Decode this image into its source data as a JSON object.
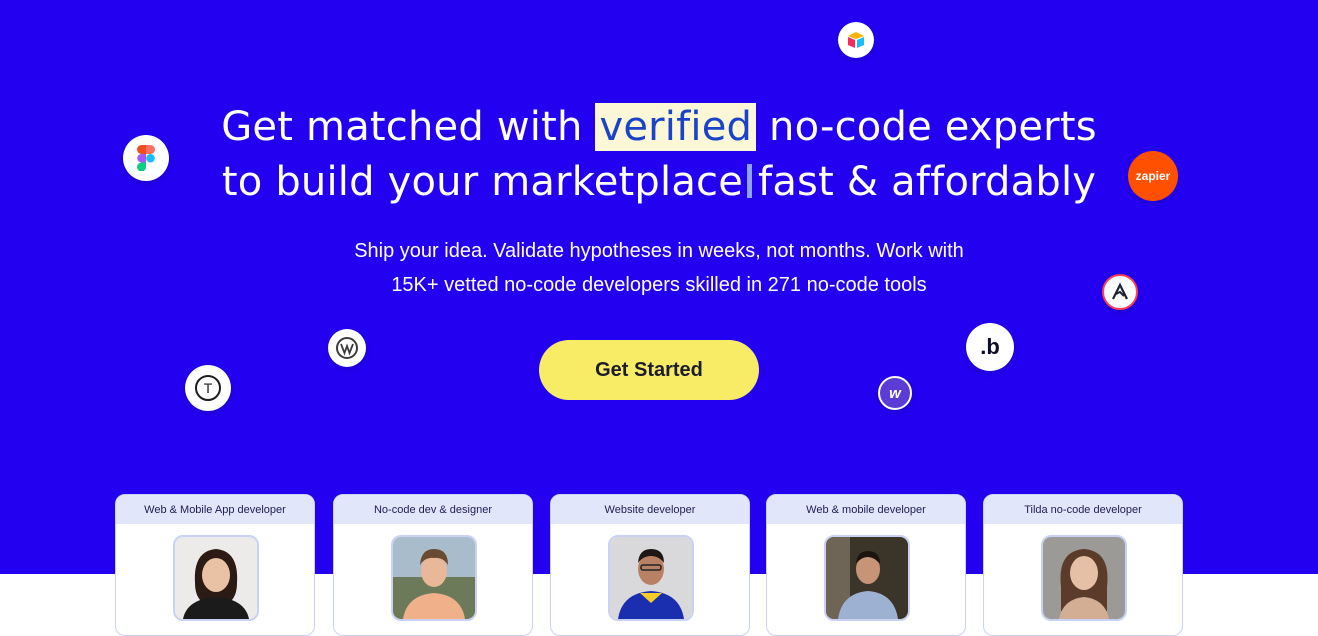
{
  "hero": {
    "headline_pre": "Get matched with",
    "headline_highlight": "verified",
    "headline_post": "no-code experts",
    "headline_line2_pre": "to build your marketplace",
    "headline_line2_post": "fast & affordably",
    "subtitle_line1": "Ship your idea. Validate hypotheses in weeks, not months. Work with",
    "subtitle_line2": "15K+ vetted no-code developers skilled in 271 no-code tools",
    "cta_label": "Get Started"
  },
  "tool_icons": [
    {
      "name": "airtable-icon"
    },
    {
      "name": "figma-icon"
    },
    {
      "name": "zapier-icon",
      "label": "zapier"
    },
    {
      "name": "adalo-icon"
    },
    {
      "name": "wordpress-icon"
    },
    {
      "name": "bubble-icon",
      "label": ".b"
    },
    {
      "name": "tilda-icon",
      "label": "T"
    },
    {
      "name": "webflow-icon",
      "label": "w"
    }
  ],
  "developers": [
    {
      "role": "Web & Mobile App developer"
    },
    {
      "role": "No-code dev & designer"
    },
    {
      "role": "Website developer"
    },
    {
      "role": "Web & mobile developer"
    },
    {
      "role": "Tilda no-code developer"
    }
  ],
  "colors": {
    "hero_bg": "#2300f0",
    "cta_bg": "#f8ec66",
    "highlight_bg": "#fbf7d7",
    "highlight_text": "#1a43c9",
    "card_head_bg": "#e2e6fb"
  }
}
